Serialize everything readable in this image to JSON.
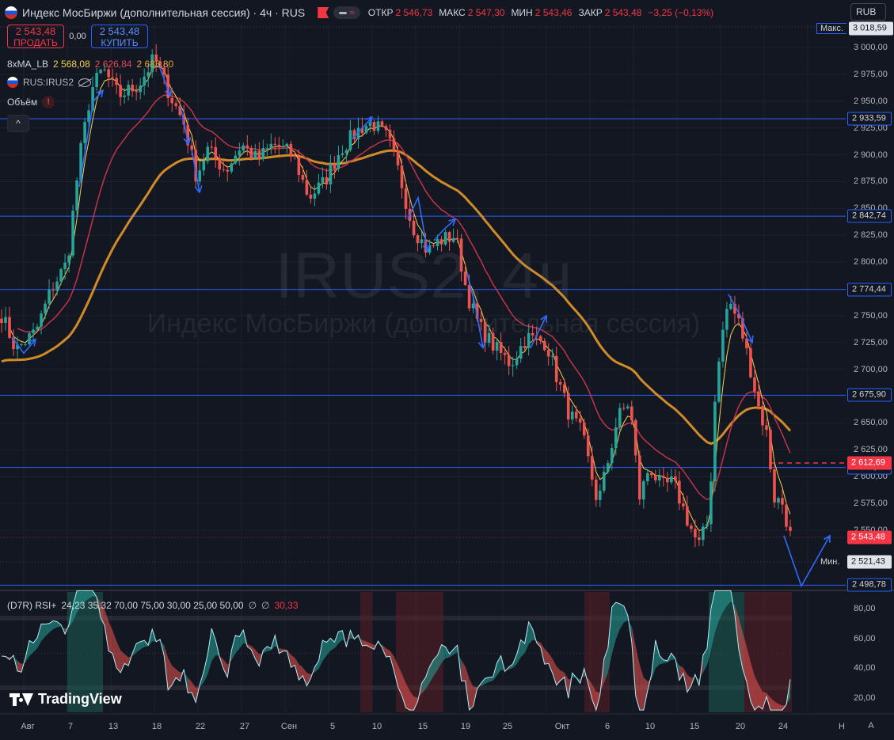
{
  "header": {
    "title": "Индекс МосБиржи (дополнительная сессия) · 4ч · RUS",
    "open_label": "ОТКР",
    "open_value": "2 546,73",
    "high_label": "МАКС",
    "high_value": "2 547,30",
    "low_label": "МИН",
    "low_value": "2 543,46",
    "close_label": "ЗАКР",
    "close_value": "2 543,48",
    "change": "−3,25 (−0,13%)",
    "pill_glyph": "≈"
  },
  "trade": {
    "sell_price": "2 543,48",
    "sell_label": "ПРОДАТЬ",
    "spread": "0,00",
    "buy_price": "2 543,48",
    "buy_label": "КУПИТЬ"
  },
  "legends": {
    "ma_name": "8xMA_LB",
    "ma_v1": "2 568,08",
    "ma_v2": "2 626,84",
    "ma_v3": "2 688,80",
    "compare": "RUS:IRUS2",
    "volume": "Объём",
    "warn_glyph": "!",
    "collapse_glyph": "^",
    "rsi_name": "(D7R) RSI+",
    "rsi_params": "24,23  35,32  70,00  75,00  30,00  25,00  50,00",
    "null_glyph": "∅",
    "rsi_last": "30,33"
  },
  "watermark": {
    "line1": "IRUS2, 4ч",
    "line2": "Индекс МосБиржи (дополнительная сессия)"
  },
  "currency": "RUB",
  "price_axis": {
    "ticks": [
      {
        "v": 3000,
        "t": "3 000,00"
      },
      {
        "v": 2975,
        "t": "2 975,00"
      },
      {
        "v": 2950,
        "t": "2 950,00"
      },
      {
        "v": 2925,
        "t": "2 925,00"
      },
      {
        "v": 2900,
        "t": "2 900,00"
      },
      {
        "v": 2875,
        "t": "2 875,00"
      },
      {
        "v": 2850,
        "t": "2 850,00"
      },
      {
        "v": 2825,
        "t": "2 825,00"
      },
      {
        "v": 2800,
        "t": "2 800,00"
      },
      {
        "v": 2750,
        "t": "2 750,00"
      },
      {
        "v": 2725,
        "t": "2 725,00"
      },
      {
        "v": 2700,
        "t": "2 700,00"
      },
      {
        "v": 2650,
        "t": "2 650,00"
      },
      {
        "v": 2625,
        "t": "2 625,00"
      },
      {
        "v": 2600,
        "t": "2 600,00"
      },
      {
        "v": 2575,
        "t": "2 575,00"
      },
      {
        "v": 2550,
        "t": "2 550,00"
      }
    ],
    "levels": [
      {
        "v": 2933.59,
        "t": "2 933,59"
      },
      {
        "v": 2842.74,
        "t": "2 842,74"
      },
      {
        "v": 2774.44,
        "t": "2 774,44"
      },
      {
        "v": 2675.9,
        "t": "2 675,90"
      },
      {
        "v": 2608.52,
        "t": "2 608,52"
      },
      {
        "v": 2498.78,
        "t": "2 498,78"
      }
    ],
    "max": {
      "v": 3018.59,
      "t": "3 018,59",
      "tag": "Макс."
    },
    "min": {
      "v": 2521.43,
      "t": "2 521,43",
      "tag": "Мин."
    },
    "last": {
      "v": 2543.48,
      "t": "2 543,48"
    },
    "alert": {
      "v": 2612.69,
      "t": "2 612,69"
    }
  },
  "rsi_axis": [
    {
      "v": 80,
      "t": "80,00"
    },
    {
      "v": 60,
      "t": "60,00"
    },
    {
      "v": 40,
      "t": "40,00"
    },
    {
      "v": 20,
      "t": "20,00"
    }
  ],
  "time_axis": [
    "Авг",
    "7",
    "13",
    "18",
    "22",
    "27",
    "Сен",
    "5",
    "10",
    "15",
    "19",
    "25",
    "Окт",
    "6",
    "10",
    "15",
    "20",
    "24",
    "Н"
  ],
  "brand": "TradingView",
  "colors": {
    "up": "#26a69a",
    "down": "#ef5350",
    "level": "#2962ff",
    "ma_fast": "#f5d14d",
    "ma_mid": "#c2334a",
    "ma_slow": "#d08b28",
    "rsi_line": "#b2ebf2"
  }
}
